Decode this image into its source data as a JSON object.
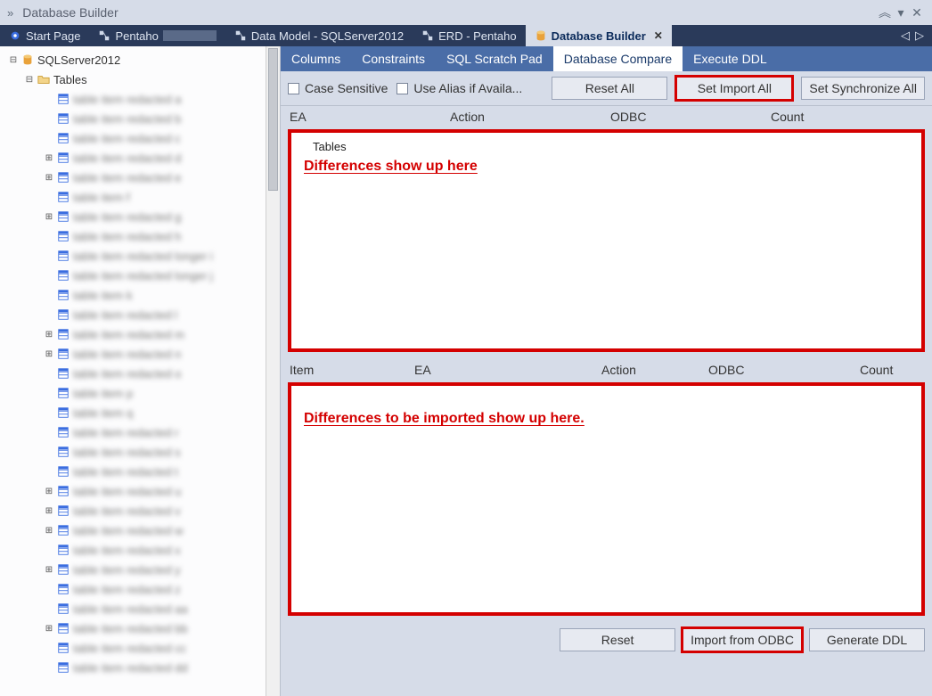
{
  "window": {
    "title": "Database Builder"
  },
  "tabs": [
    {
      "label": "Start Page"
    },
    {
      "label": "Pentaho"
    },
    {
      "label": "Data Model - SQLServer2012"
    },
    {
      "label": "ERD - Pentaho"
    },
    {
      "label": "Database Builder",
      "active": true
    }
  ],
  "subtabs": {
    "columns": "Columns",
    "constraints": "Constraints",
    "scratchpad": "SQL Scratch Pad",
    "compare": "Database Compare",
    "executeddl": "Execute DDL"
  },
  "toolbar": {
    "case_sensitive": "Case Sensitive",
    "use_alias": "Use Alias if Availa...",
    "reset_all": "Reset All",
    "set_import_all": "Set Import All",
    "set_sync_all": "Set Synchronize All"
  },
  "upper_headers": {
    "ea": "EA",
    "action": "Action",
    "odbc": "ODBC",
    "count": "Count"
  },
  "upper_panel": {
    "tables_label": "Tables",
    "note": "Differences show up here"
  },
  "lower_headers": {
    "item": "Item",
    "ea": "EA",
    "action": "Action",
    "odbc": "ODBC",
    "count": "Count"
  },
  "lower_panel": {
    "note": "Differences to be imported show up here."
  },
  "bottom": {
    "reset": "Reset",
    "import_odbc": "Import from ODBC",
    "generate_ddl": "Generate DDL"
  },
  "tree": {
    "root": "SQLServer2012",
    "tables_label": "Tables",
    "items": [
      {
        "exp": false,
        "text": "table item redacted a"
      },
      {
        "exp": false,
        "text": "table item redacted b"
      },
      {
        "exp": false,
        "text": "table item redacted c"
      },
      {
        "exp": true,
        "text": "table item redacted d"
      },
      {
        "exp": true,
        "text": "table item redacted e"
      },
      {
        "exp": false,
        "text": "table item f"
      },
      {
        "exp": true,
        "text": "table item redacted g"
      },
      {
        "exp": false,
        "text": "table item redacted h"
      },
      {
        "exp": false,
        "text": "table item redacted longer i"
      },
      {
        "exp": false,
        "text": "table item redacted longer j"
      },
      {
        "exp": false,
        "text": "table item k"
      },
      {
        "exp": false,
        "text": "table item redacted l"
      },
      {
        "exp": true,
        "text": "table item redacted m"
      },
      {
        "exp": true,
        "text": "table item redacted n"
      },
      {
        "exp": false,
        "text": "table item redacted o"
      },
      {
        "exp": false,
        "text": "table item p"
      },
      {
        "exp": false,
        "text": "table item q"
      },
      {
        "exp": false,
        "text": "table item redacted r"
      },
      {
        "exp": false,
        "text": "table item redacted s"
      },
      {
        "exp": false,
        "text": "table item redacted t"
      },
      {
        "exp": true,
        "text": "table item redacted u"
      },
      {
        "exp": true,
        "text": "table item redacted v"
      },
      {
        "exp": true,
        "text": "table item redacted w"
      },
      {
        "exp": false,
        "text": "table item redacted x"
      },
      {
        "exp": true,
        "text": "table item redacted y"
      },
      {
        "exp": false,
        "text": "table item redacted z"
      },
      {
        "exp": false,
        "text": "table item redacted aa"
      },
      {
        "exp": true,
        "text": "table item redacted bb"
      },
      {
        "exp": false,
        "text": "table item redacted cc"
      },
      {
        "exp": false,
        "text": "table item redacted dd"
      }
    ]
  }
}
